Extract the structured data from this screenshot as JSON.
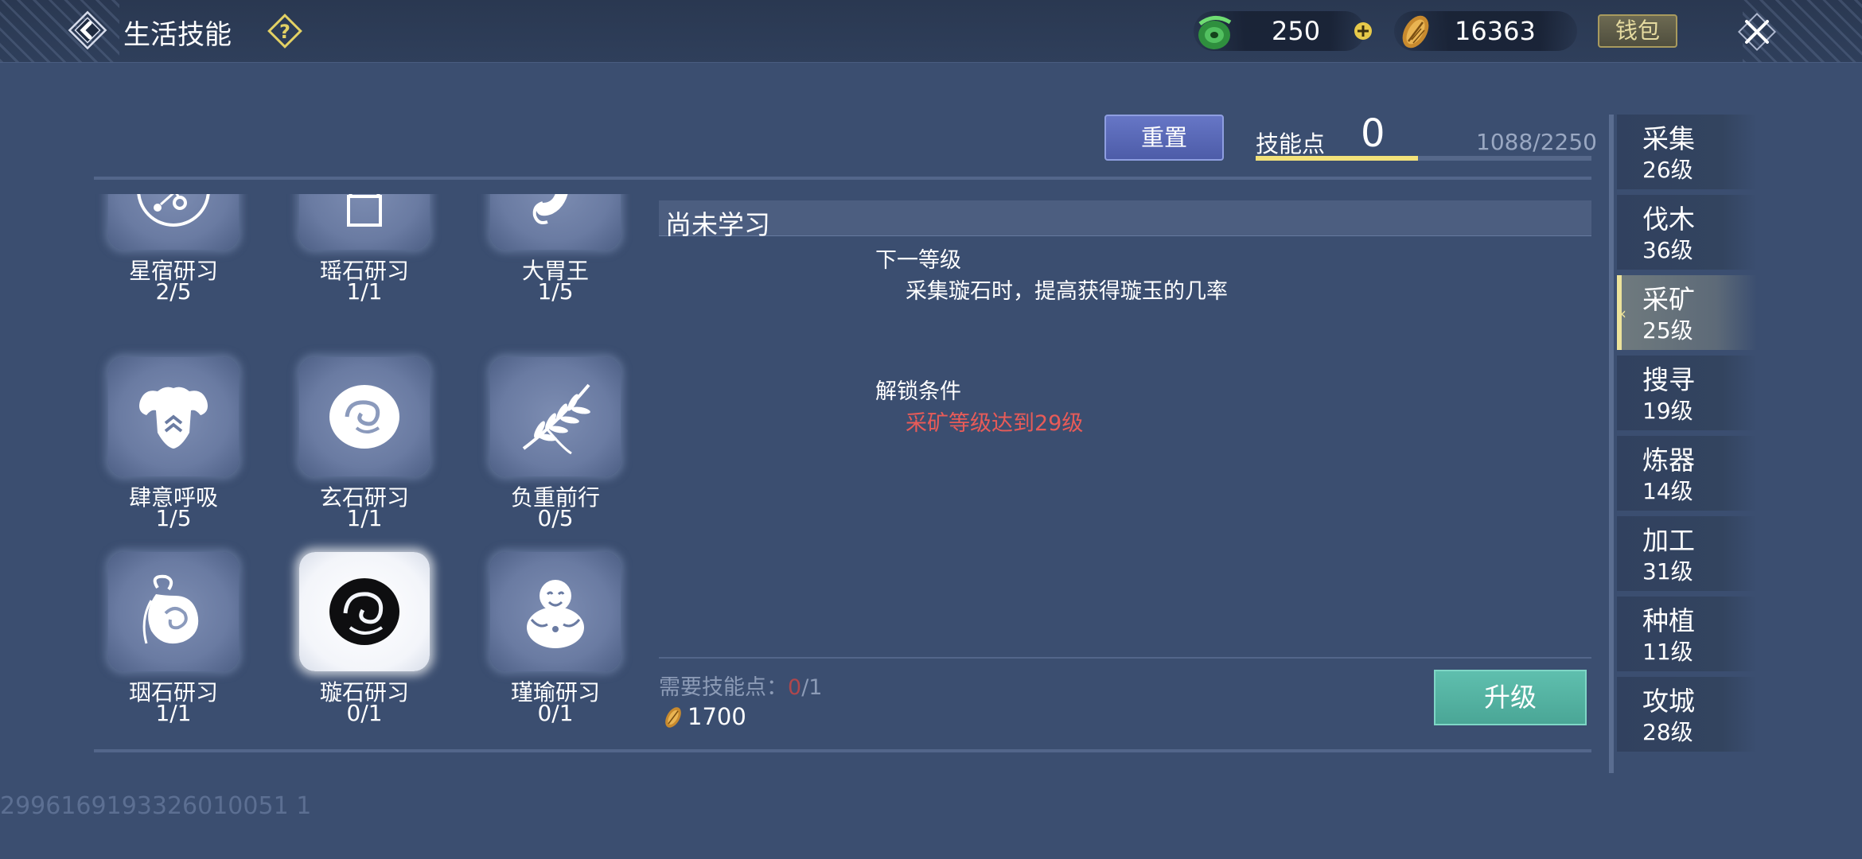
{
  "header": {
    "title": "生活技能",
    "currencies": [
      {
        "icon": "jade-coin-icon",
        "value": "250"
      },
      {
        "icon": "gold-seed-icon",
        "value": "16363"
      }
    ],
    "wallet_label": "钱包"
  },
  "skill_points": {
    "reset_label": "重置",
    "label": "技能点",
    "value": "0",
    "progress_text": "1088/2250",
    "progress": 0.4836
  },
  "skills": [
    {
      "name": "星宿研习",
      "level": "2/5",
      "icon": "constellation-icon"
    },
    {
      "name": "瑶石研习",
      "level": "1/1",
      "icon": "stone-lion-seal-icon"
    },
    {
      "name": "大胃王",
      "level": "1/5",
      "icon": "stomach-icon"
    },
    {
      "name": "肆意呼吸",
      "level": "1/5",
      "icon": "muscle-torso-icon"
    },
    {
      "name": "玄石研习",
      "level": "1/1",
      "icon": "jade-disc-icon"
    },
    {
      "name": "负重前行",
      "level": "0/5",
      "icon": "leaf-branch-icon"
    },
    {
      "name": "珚石研习",
      "level": "1/1",
      "icon": "jade-pendant-icon"
    },
    {
      "name": "璇石研习",
      "level": "0/1",
      "icon": "black-jade-icon",
      "selected": true
    },
    {
      "name": "瑾瑜研习",
      "level": "0/1",
      "icon": "laughing-buddha-icon"
    }
  ],
  "detail": {
    "status": "尚未学习",
    "next_level_heading": "下一等级",
    "next_level_desc": "采集璇石时，提高获得璇玉的几率",
    "unlock_heading": "解锁条件",
    "unlock_desc": "采矿等级达到29级",
    "required_label": "需要技能点：",
    "required_have": "0",
    "required_sep": "/",
    "required_need": "1",
    "cost_icon": "gold-seed-icon",
    "cost_value": "1700",
    "upgrade_label": "升级"
  },
  "categories": [
    {
      "name": "采集",
      "level": "26级"
    },
    {
      "name": "伐木",
      "level": "36级"
    },
    {
      "name": "采矿",
      "level": "25级",
      "active": true
    },
    {
      "name": "搜寻",
      "level": "19级"
    },
    {
      "name": "炼器",
      "level": "14级"
    },
    {
      "name": "加工",
      "level": "31级"
    },
    {
      "name": "种植",
      "level": "11级"
    },
    {
      "name": "攻城",
      "level": "28级"
    }
  ],
  "uid": "2996169193326010051 1",
  "colors": {
    "background": "#3b4e70",
    "accent_gold": "#f3e27a",
    "warning_red": "#e85b58",
    "upgrade_green": "#4aa696",
    "reset_blue": "#5565b4"
  }
}
